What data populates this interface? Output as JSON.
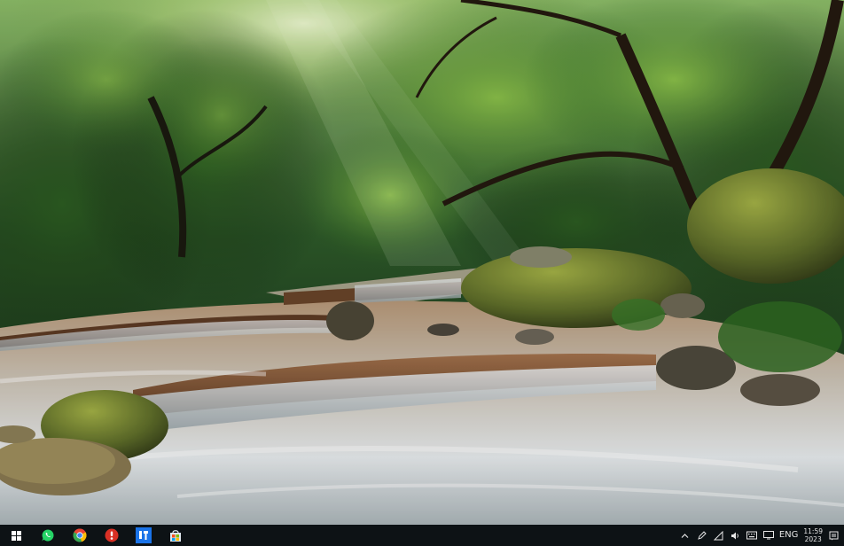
{
  "wallpaper": {
    "description_icon": "forest-river-wallpaper"
  },
  "taskbar": {
    "start_icon": "windows-logo-icon",
    "pinned": [
      {
        "icon": "whatsapp-icon"
      },
      {
        "icon": "chrome-icon"
      },
      {
        "icon": "security-app-icon"
      },
      {
        "icon": "blue-app-icon"
      },
      {
        "icon": "store-bag-icon"
      }
    ],
    "tray": {
      "chevron_icon": "chevron-up-icon",
      "icons": [
        "pen-icon",
        "network-icon",
        "volume-icon",
        "keyboard-icon",
        "display-icon"
      ],
      "language": "ENG",
      "clock_time": "11:59",
      "clock_date": "2023"
    },
    "colors": {
      "background": "#0e1216",
      "chrome_red": "#ea4335",
      "chrome_green": "#34a853",
      "chrome_yellow": "#fbbc05",
      "chrome_blue": "#4285f4",
      "whatsapp": "#25d366",
      "app_blue": "#1a73e8"
    }
  }
}
